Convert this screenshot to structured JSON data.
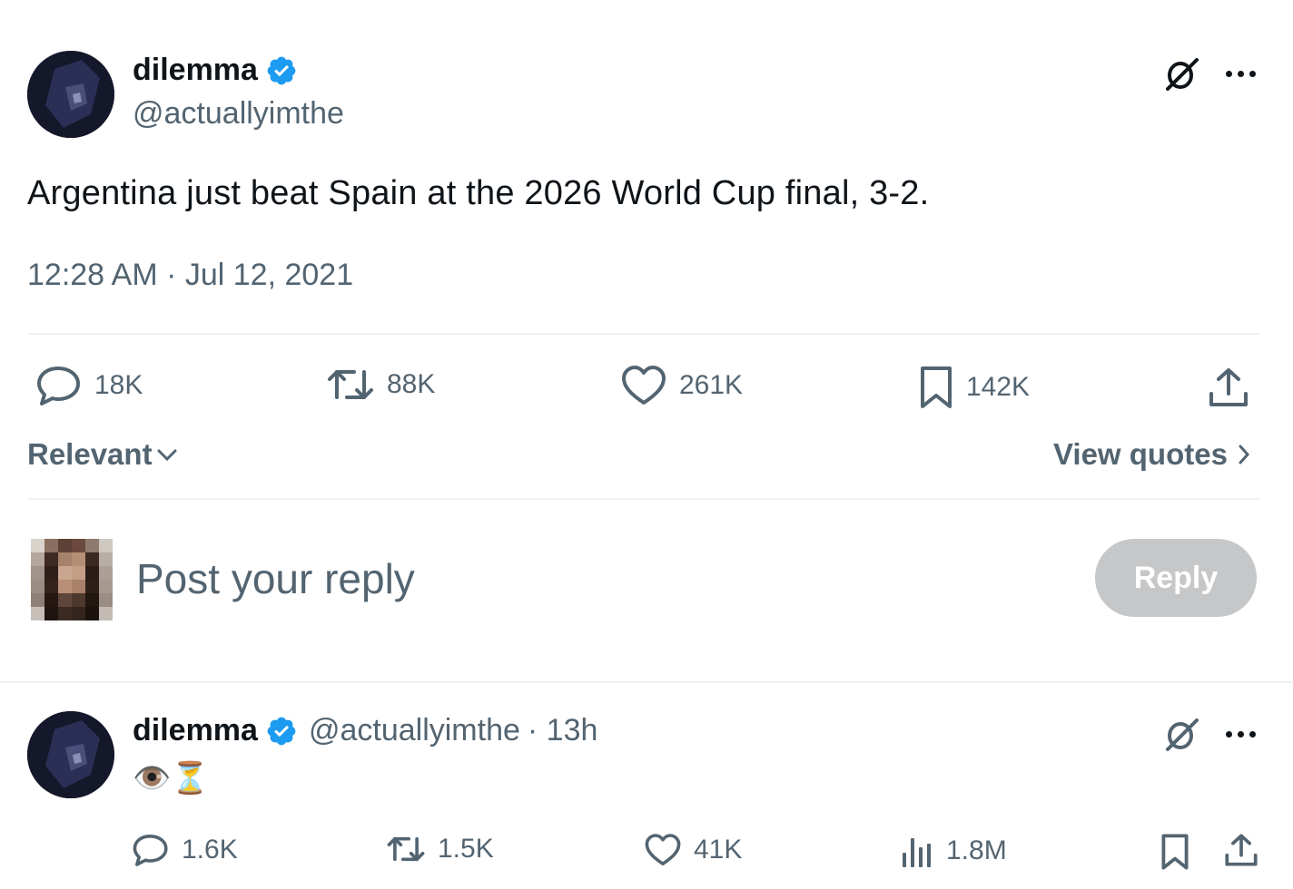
{
  "main_post": {
    "author_name": "dilemma",
    "author_handle": "@actuallyimthe",
    "text": "Argentina just beat Spain at the 2026 World Cup final, 3-2.",
    "timestamp": "12:28 AM · Jul 12, 2021",
    "stats": {
      "replies": "18K",
      "reposts": "88K",
      "likes": "261K",
      "bookmarks": "142K"
    }
  },
  "sort": {
    "label": "Relevant",
    "view_quotes": "View quotes"
  },
  "compose": {
    "placeholder": "Post your reply",
    "reply_button": "Reply"
  },
  "reply_post": {
    "author_name": "dilemma",
    "author_handle": "@actuallyimthe",
    "age": "· 13h",
    "text": "👁️⏳",
    "stats": {
      "replies": "1.6K",
      "reposts": "1.5K",
      "likes": "41K",
      "views": "1.8M"
    }
  },
  "colors": {
    "verified": "#1d9bf0",
    "text": "#0f1419",
    "muted": "#536471",
    "reply_button_disabled": "#c5c7c9"
  },
  "icons": [
    "verified-badge-icon",
    "grok-icon",
    "more-icon",
    "reply-icon",
    "repost-icon",
    "like-icon",
    "bookmark-icon",
    "share-icon",
    "views-icon",
    "chevron-down-icon",
    "chevron-right-icon"
  ]
}
